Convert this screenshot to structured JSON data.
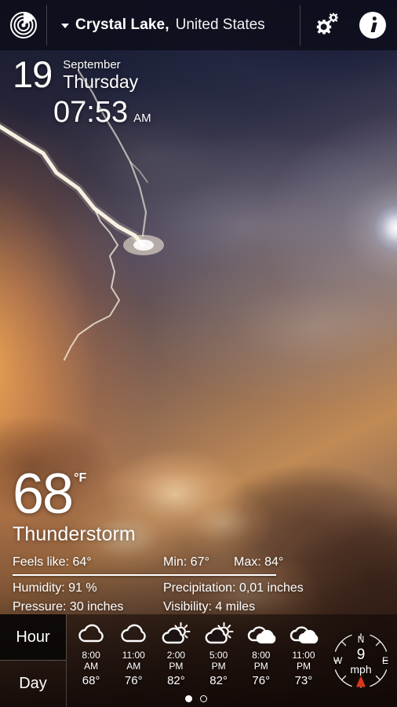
{
  "topbar": {
    "radar_icon": "radar-icon",
    "location_caret": "chevron-down-icon",
    "city": "Crystal Lake,",
    "country": "United States",
    "settings_icon": "gear-icon",
    "info_icon": "info-icon"
  },
  "datetime": {
    "day_number": "19",
    "month": "September",
    "weekday": "Thursday",
    "time": "07:53",
    "ampm": "AM"
  },
  "current": {
    "temperature": "68",
    "unit": "°F",
    "condition": "Thunderstorm"
  },
  "details": {
    "feels_like": "Feels like: 64°",
    "min": "Min: 67°",
    "max": "Max: 84°",
    "humidity": "Humidity: 91 %",
    "precipitation": "Precipitation: 0,01 inches",
    "pressure": "Pressure: 30 inches",
    "visibility": "Visibility: 4 miles"
  },
  "forecast": {
    "tabs": [
      {
        "label": "Hour",
        "active": true
      },
      {
        "label": "Day",
        "active": false
      }
    ],
    "hours": [
      {
        "time_hour": "8:00",
        "time_ampm": "AM",
        "temp": "68°",
        "icon": "cloud-outline-icon"
      },
      {
        "time_hour": "11:00",
        "time_ampm": "AM",
        "temp": "76°",
        "icon": "cloud-outline-icon"
      },
      {
        "time_hour": "2:00",
        "time_ampm": "PM",
        "temp": "82°",
        "icon": "sun-behind-cloud-icon"
      },
      {
        "time_hour": "5:00",
        "time_ampm": "PM",
        "temp": "82°",
        "icon": "sun-behind-cloud-icon"
      },
      {
        "time_hour": "8:00",
        "time_ampm": "PM",
        "temp": "76°",
        "icon": "cloud-filled-icon"
      },
      {
        "time_hour": "11:00",
        "time_ampm": "PM",
        "temp": "73°",
        "icon": "cloud-filled-icon"
      }
    ],
    "page_dots": [
      {
        "active": true
      },
      {
        "active": false
      }
    ]
  },
  "wind": {
    "north_label": "N",
    "west_label": "W",
    "east_label": "E",
    "speed": "9",
    "unit": "mph",
    "pointer_direction": "south",
    "pointer_color": "#d9381e"
  }
}
